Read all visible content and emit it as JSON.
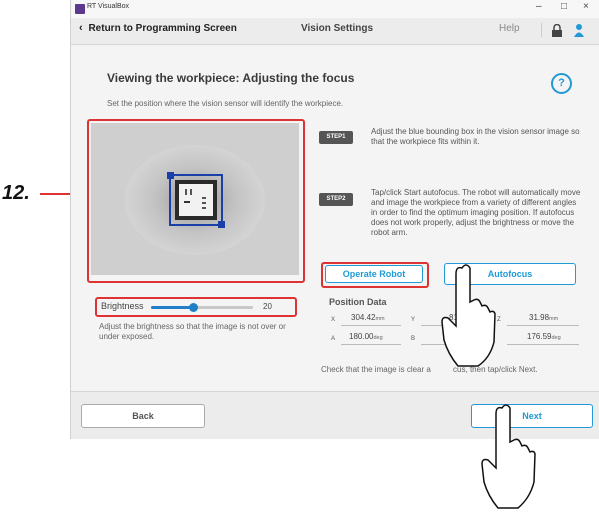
{
  "window": {
    "title": "RT VisualBox",
    "minimize": "–",
    "maximize": "□",
    "close": "×"
  },
  "nav": {
    "back_label": "Return to Programming Screen",
    "title": "Vision Settings",
    "help": "Help"
  },
  "page": {
    "heading": "Viewing the workpiece: Adjusting the focus",
    "help_icon": "?",
    "subtitle": "Set the position where the vision sensor will identify the workpiece."
  },
  "steps": [
    {
      "badge": "STEP1",
      "text": "Adjust the blue bounding box in the vision sensor image so that the workpiece fits within it."
    },
    {
      "badge": "STEP2",
      "text": "Tap/click Start autofocus. The robot will automatically move and image the workpiece from a variety of different angles in order to find the optimum imaging position. If autofocus does not work properly, adjust the brightness or move the robot arm."
    }
  ],
  "buttons": {
    "operate_robot": "Operate Robot",
    "autofocus": "Autofocus",
    "back": "Back",
    "next": "Next"
  },
  "brightness": {
    "label": "Brightness",
    "value": "20",
    "level_fraction": 0.43,
    "hint": "Adjust the brightness so that the image is not over or under exposed."
  },
  "position": {
    "title": "Position Data",
    "x": {
      "label": "X",
      "value": "304.42",
      "unit": "mm"
    },
    "y": {
      "label": "Y",
      "value": "81",
      "unit": ""
    },
    "z": {
      "label": "Z",
      "value": "31.98",
      "unit": "mm"
    },
    "a": {
      "label": "A",
      "value": "180.00",
      "unit": "deg"
    },
    "b": {
      "label": "B",
      "value": "-0",
      "unit": ""
    },
    "c": {
      "label": "",
      "value": "176.59",
      "unit": "deg"
    }
  },
  "check_text": "Check that the image is clear a          cus, then tap/click Next.",
  "callout": "12.",
  "colors": {
    "accent": "#1f9ad6",
    "highlight": "#d33333",
    "bounding_box": "#1a3fa8"
  }
}
